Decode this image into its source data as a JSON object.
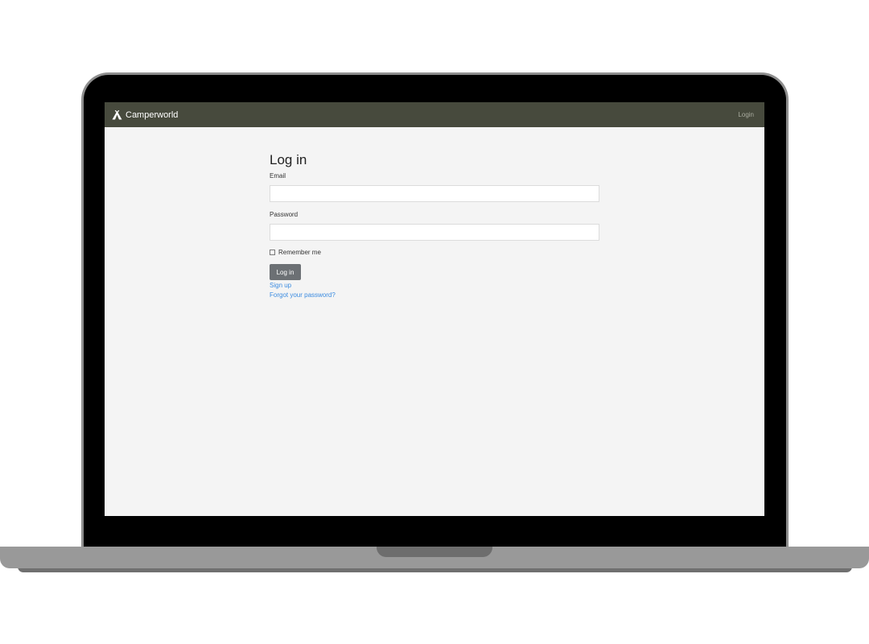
{
  "navbar": {
    "brand_label": "Camperworld",
    "brand_icon": "tent-icon",
    "login_link": "Login",
    "background_color": "#474a3d"
  },
  "form": {
    "title": "Log in",
    "email_label": "Email",
    "email_value": "",
    "password_label": "Password",
    "password_value": "",
    "remember_label": "Remember me",
    "remember_checked": false,
    "submit_label": "Log in"
  },
  "links": {
    "sign_up": "Sign up",
    "forgot_password": "Forgot your password?"
  },
  "colors": {
    "link": "#3b8be0",
    "button": "#6c7074",
    "page_background": "#f4f4f4"
  }
}
